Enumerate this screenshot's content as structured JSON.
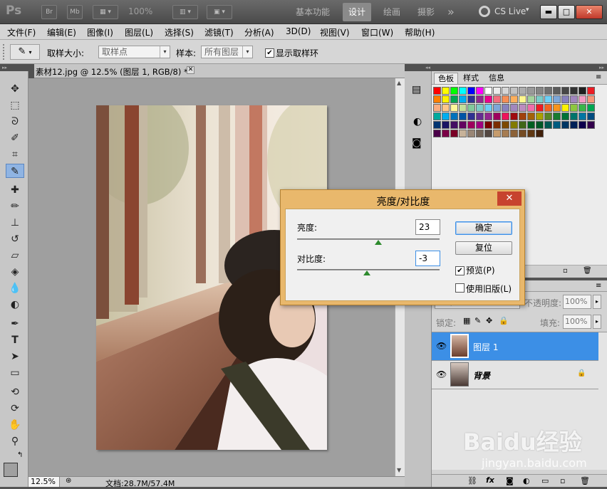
{
  "app": {
    "logo": "Ps",
    "bridge_btn": "Br",
    "minibridge_btn": "Mb",
    "zoom_value": "100%",
    "workspaces": [
      "基本功能",
      "设计",
      "绘画",
      "摄影"
    ],
    "active_workspace": "设计",
    "more_glyph": "»",
    "cslive": "CS Live"
  },
  "menu": [
    "文件(F)",
    "编辑(E)",
    "图像(I)",
    "图层(L)",
    "选择(S)",
    "滤镜(T)",
    "分析(A)",
    "3D(D)",
    "视图(V)",
    "窗口(W)",
    "帮助(H)"
  ],
  "options": {
    "sample_size_label": "取样大小:",
    "sample_size_value": "取样点",
    "sample_label": "样本:",
    "sample_value": "所有图层",
    "show_ring_label": "显示取样环",
    "show_ring_checked": true
  },
  "document": {
    "tab_title": "素材12.jpg @ 12.5% (图层 1, RGB/8) *",
    "zoom": "12.5%",
    "doc_info": "文档:28.7M/57.4M"
  },
  "swatches_panel": {
    "tabs": [
      "色板",
      "样式",
      "信息"
    ],
    "colors": [
      "#ff0000",
      "#ffff00",
      "#00ff00",
      "#00ffff",
      "#0000ff",
      "#ff00ff",
      "#ffffff",
      "#ebebeb",
      "#d6d6d6",
      "#c2c2c2",
      "#adadad",
      "#999999",
      "#858585",
      "#707070",
      "#5c5c5c",
      "#474747",
      "#333333",
      "#1f1f1f",
      "#ed1c24",
      "#ff7f00",
      "#fff200",
      "#00a651",
      "#00aeef",
      "#2e3192",
      "#92278f",
      "#ec008c",
      "#f26d7d",
      "#f68e56",
      "#fbaf5d",
      "#fff68f",
      "#a3d39c",
      "#7accc8",
      "#6dcff6",
      "#7da7d9",
      "#8781bd",
      "#a186be",
      "#f49ac2",
      "#f7977a",
      "#f9ad81",
      "#fdc68a",
      "#fff79a",
      "#c4df9b",
      "#82ca9c",
      "#7bcdc8",
      "#6ecff6",
      "#7ea7d8",
      "#8882be",
      "#a187be",
      "#bc8cbf",
      "#f06eaa",
      "#ed1c24",
      "#f26522",
      "#f7941d",
      "#fff200",
      "#8dc73f",
      "#39b54a",
      "#00a651",
      "#00a99d",
      "#00aeef",
      "#0072bc",
      "#0054a6",
      "#2e3192",
      "#662d91",
      "#92278f",
      "#9e005d",
      "#ed145b",
      "#9e0b0f",
      "#a0410d",
      "#a3620a",
      "#aba000",
      "#598527",
      "#197b30",
      "#007236",
      "#00746b",
      "#0076a3",
      "#004b80",
      "#003471",
      "#1b1464",
      "#440e62",
      "#630460",
      "#9e005d",
      "#a0007f",
      "#790000",
      "#7b2e00",
      "#7d4900",
      "#827b00",
      "#406618",
      "#005e20",
      "#005826",
      "#005952",
      "#005b7f",
      "#003663",
      "#002157",
      "#0d004c",
      "#32004b",
      "#4b0049",
      "#7b0046",
      "#7a0026",
      "#c7b299",
      "#998675",
      "#736357",
      "#534741",
      "#c69c6d",
      "#a67c52",
      "#8c6239",
      "#754c24",
      "#603813",
      "#42210b"
    ]
  },
  "layers_panel": {
    "blend_mode": "正常",
    "opacity_label": "不透明度:",
    "opacity_value": "100%",
    "lock_label": "锁定:",
    "fill_label": "填充:",
    "fill_value": "100%",
    "layers": [
      {
        "name": "图层 1",
        "selected": true,
        "locked": false
      },
      {
        "name": "背景",
        "selected": false,
        "locked": true
      }
    ]
  },
  "dialog": {
    "title": "亮度/对比度",
    "brightness_label": "亮度:",
    "brightness_value": "23",
    "contrast_label": "对比度:",
    "contrast_value": "-3",
    "ok": "确定",
    "reset": "复位",
    "preview_label": "预览(P)",
    "preview_checked": true,
    "legacy_label": "使用旧版(L)",
    "legacy_checked": false,
    "brightness_fraction": 0.57,
    "contrast_fraction": 0.49
  },
  "watermark": {
    "brand": "Baidu经验",
    "url": "jingyan.baidu.com"
  },
  "colors": {
    "dialog_frame": "#e9b86c",
    "selection_blue": "#3c8fe6",
    "slider_thumb": "#2d8a2d"
  }
}
